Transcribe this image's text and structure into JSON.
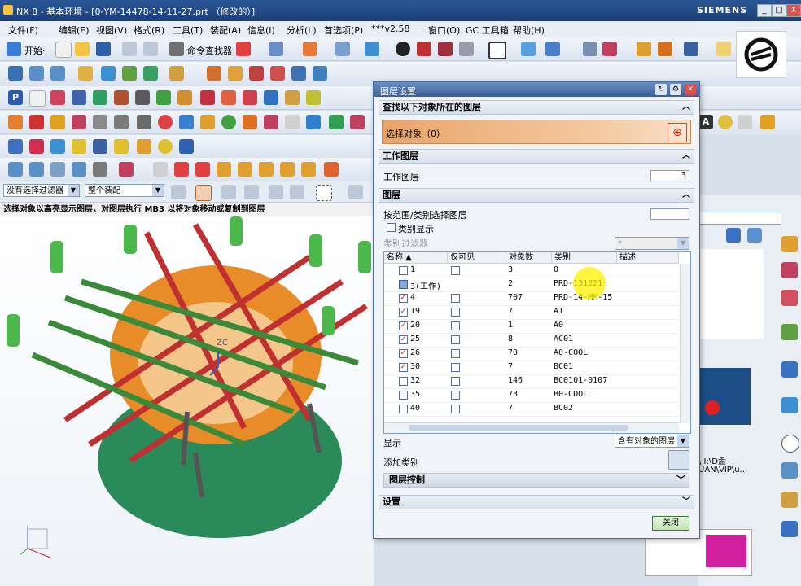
{
  "window": {
    "title": "NX 8 - 基本环境 - [0-YM-14478-14-11-27.prt （修改的）]",
    "brand": "SIEMENS",
    "min": "_",
    "max": "□",
    "close": "X"
  },
  "menu": [
    "文件(F)",
    "编辑(E)",
    "视图(V)",
    "格式(R)",
    "工具(T)",
    "装配(A)",
    "信息(I)",
    "分析(L)",
    "首选项(P)",
    "***v2.58",
    "窗口(O)",
    "GC 工具箱",
    "帮助(H)"
  ],
  "toolbar": {
    "start_label": "开始·",
    "cmd_finder": "命令查找器"
  },
  "filters": {
    "select_filter": "没有选择过滤器",
    "assembly": "整个装配"
  },
  "status": "选择对象以高亮显示图层，对图层执行 MB3 以将对象移动或复制到图层",
  "viewport": {
    "axis_label": "ZC"
  },
  "dialog": {
    "title": "图层设置",
    "sec_find": "查找以下对象所在的图层",
    "select_object": "选择对象（0）",
    "sec_work": "工作图层",
    "work_layer_label": "工作图层",
    "work_layer_value": "3",
    "sec_layers": "图层",
    "range_select_label": "按范围/类别选择图层",
    "category_display": "类别显示",
    "category_filter": "类别过滤器",
    "category_filter_value": "*",
    "columns": [
      "名称",
      "仅可见",
      "对象数",
      "类别",
      "描述"
    ],
    "rows": [
      {
        "name": "1",
        "checked": false,
        "visible_only": false,
        "count": "3",
        "category": "0",
        "work": false
      },
      {
        "name": "3(工作)",
        "checked": false,
        "visible_only": false,
        "count": "2",
        "category": "PRD-131221",
        "work": true
      },
      {
        "name": "4",
        "checked": true,
        "visible_only": false,
        "count": "707",
        "category": "PRD-14-MM-15",
        "work": false
      },
      {
        "name": "19",
        "checked": true,
        "visible_only": false,
        "count": "7",
        "category": "A1",
        "work": false
      },
      {
        "name": "20",
        "checked": true,
        "visible_only": false,
        "count": "1",
        "category": "A0",
        "work": false
      },
      {
        "name": "25",
        "checked": true,
        "visible_only": false,
        "count": "8",
        "category": "AC01",
        "work": false
      },
      {
        "name": "26",
        "checked": true,
        "visible_only": false,
        "count": "70",
        "category": "A0-COOL",
        "work": false
      },
      {
        "name": "30",
        "checked": true,
        "visible_only": false,
        "count": "7",
        "category": "BC01",
        "work": false
      },
      {
        "name": "32",
        "checked": false,
        "visible_only": false,
        "count": "146",
        "category": "BC0101-0107",
        "work": false
      },
      {
        "name": "35",
        "checked": false,
        "visible_only": false,
        "count": "73",
        "category": "B0-COOL",
        "work": false
      },
      {
        "name": "40",
        "checked": false,
        "visible_only": false,
        "count": "7",
        "category": "BC02",
        "work": false
      }
    ],
    "display_label": "显示",
    "display_value": "含有对象的图层",
    "add_category": "添加类别",
    "layer_control": "图层控制",
    "settings": "设置",
    "close_btn": "关闭"
  },
  "right_panel": {
    "text1": "\\ I:\\D盘",
    "text2": "UAN\\VIP\\u..."
  },
  "colors": {
    "accent": "#3c5f98",
    "select_orange": "#e9a46a",
    "check_red": "#d02020"
  }
}
